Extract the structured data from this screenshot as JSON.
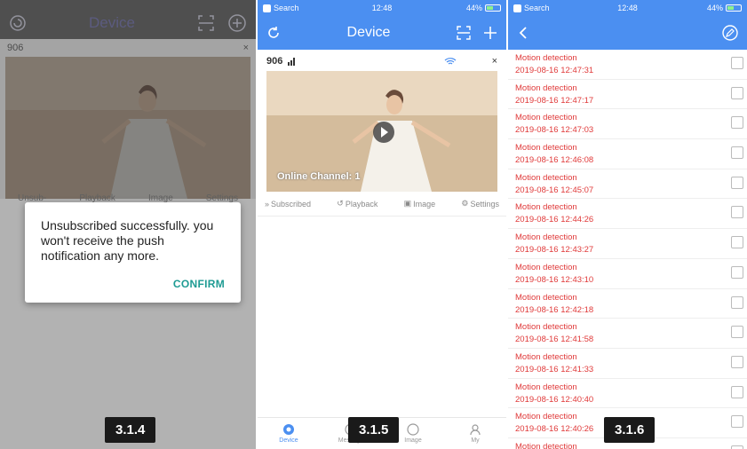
{
  "panel1": {
    "title": "Device",
    "device_name": "906",
    "actions": [
      "Unsub-",
      "Playback",
      "Image",
      "Settings"
    ],
    "dialog": {
      "message": "Unsubscribed successfully. you won't receive the push notification any more.",
      "confirm_label": "CONFIRM"
    },
    "step_label": "3.1.4"
  },
  "panel2": {
    "status": {
      "carrier": "Search",
      "time": "12:48",
      "battery": "44%"
    },
    "title": "Device",
    "device_name": "906",
    "online_channel": "Online Channel: 1",
    "actions": [
      {
        "icon": "subscribed-icon",
        "label": "Subscribed"
      },
      {
        "icon": "playback-icon",
        "label": "Playback"
      },
      {
        "icon": "image-icon",
        "label": "Image"
      },
      {
        "icon": "settings-icon",
        "label": "Settings"
      }
    ],
    "tabs": [
      {
        "label": "Device",
        "active": true
      },
      {
        "label": "Message",
        "active": false
      },
      {
        "label": "Image",
        "active": false
      },
      {
        "label": "My",
        "active": false
      }
    ],
    "step_label": "3.1.5"
  },
  "panel3": {
    "status": {
      "carrier": "Search",
      "time": "12:48",
      "battery": "44%"
    },
    "events": [
      {
        "title": "Motion detection",
        "time": "2019-08-16 12:47:31"
      },
      {
        "title": "Motion detection",
        "time": "2019-08-16 12:47:17"
      },
      {
        "title": "Motion detection",
        "time": "2019-08-16 12:47:03"
      },
      {
        "title": "Motion detection",
        "time": "2019-08-16 12:46:08"
      },
      {
        "title": "Motion detection",
        "time": "2019-08-16 12:45:07"
      },
      {
        "title": "Motion detection",
        "time": "2019-08-16 12:44:26"
      },
      {
        "title": "Motion detection",
        "time": "2019-08-16 12:43:27"
      },
      {
        "title": "Motion detection",
        "time": "2019-08-16 12:43:10"
      },
      {
        "title": "Motion detection",
        "time": "2019-08-16 12:42:18"
      },
      {
        "title": "Motion detection",
        "time": "2019-08-16 12:41:58"
      },
      {
        "title": "Motion detection",
        "time": "2019-08-16 12:41:33"
      },
      {
        "title": "Motion detection",
        "time": "2019-08-16 12:40:40"
      },
      {
        "title": "Motion detection",
        "time": "2019-08-16 12:40:26"
      },
      {
        "title": "Motion detection",
        "time": ""
      }
    ],
    "step_label": "3.1.6"
  },
  "colors": {
    "header_blue": "#4b8ff1",
    "alert_red": "#e03a3a",
    "confirm_teal": "#1e9b93"
  }
}
